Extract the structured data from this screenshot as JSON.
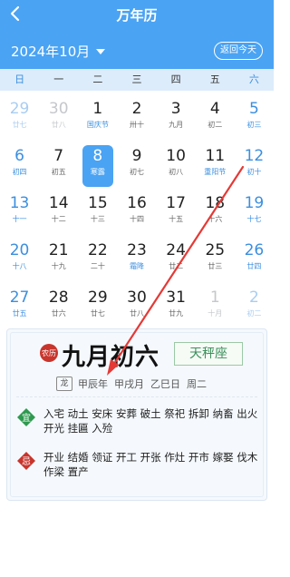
{
  "header": {
    "title": "万年历",
    "month": "2024年10月",
    "today_button": "返回今天"
  },
  "weekdays": [
    "日",
    "一",
    "二",
    "三",
    "四",
    "五",
    "六"
  ],
  "weeks": [
    [
      {
        "d": "29",
        "l": "廿七",
        "dim": true
      },
      {
        "d": "30",
        "l": "廿八",
        "dim": true
      },
      {
        "d": "1",
        "l": "国庆节",
        "fest": true
      },
      {
        "d": "2",
        "l": "卅十"
      },
      {
        "d": "3",
        "l": "九月"
      },
      {
        "d": "4",
        "l": "初二"
      },
      {
        "d": "5",
        "l": "初三"
      }
    ],
    [
      {
        "d": "6",
        "l": "初四"
      },
      {
        "d": "7",
        "l": "初五"
      },
      {
        "d": "8",
        "l": "寒露",
        "sel": true
      },
      {
        "d": "9",
        "l": "初七"
      },
      {
        "d": "10",
        "l": "初八"
      },
      {
        "d": "11",
        "l": "重阳节",
        "fest": true
      },
      {
        "d": "12",
        "l": "初十"
      }
    ],
    [
      {
        "d": "13",
        "l": "十一"
      },
      {
        "d": "14",
        "l": "十二"
      },
      {
        "d": "15",
        "l": "十三"
      },
      {
        "d": "16",
        "l": "十四"
      },
      {
        "d": "17",
        "l": "十五"
      },
      {
        "d": "18",
        "l": "十六"
      },
      {
        "d": "19",
        "l": "十七"
      }
    ],
    [
      {
        "d": "20",
        "l": "十八"
      },
      {
        "d": "21",
        "l": "十九"
      },
      {
        "d": "22",
        "l": "二十"
      },
      {
        "d": "23",
        "l": "霜降",
        "fest": true
      },
      {
        "d": "24",
        "l": "廿二"
      },
      {
        "d": "25",
        "l": "廿三"
      },
      {
        "d": "26",
        "l": "廿四"
      }
    ],
    [
      {
        "d": "27",
        "l": "廿五"
      },
      {
        "d": "28",
        "l": "廿六"
      },
      {
        "d": "29",
        "l": "廿七"
      },
      {
        "d": "30",
        "l": "廿八"
      },
      {
        "d": "31",
        "l": "廿九"
      },
      {
        "d": "1",
        "l": "十月",
        "dim": true
      },
      {
        "d": "2",
        "l": "初二",
        "dim": true
      }
    ]
  ],
  "info": {
    "nongli_badge": "农历",
    "lunar_date": "九月初六",
    "zodiac": "天秤座",
    "dragon_icon_text": "龙",
    "year_gz": "甲辰年",
    "month_gz": "甲戌月",
    "day_gz": "乙巳日",
    "week_no": "周二",
    "yi_label": "宜",
    "yi": "入宅 动土 安床 安葬 破土 祭祀 拆卸 纳畜 出火 开光 挂匾 入殓",
    "ji_label": "忌",
    "ji": "开业 结婚 领证 开工 开张 作灶 开市 嫁娶 伐木 作梁 置产"
  },
  "colors": {
    "primary": "#4aa3f3",
    "weekend": "#3b8fe0",
    "yi": "#2e9a4f",
    "ji": "#c8352d",
    "arrow": "#e53935"
  }
}
